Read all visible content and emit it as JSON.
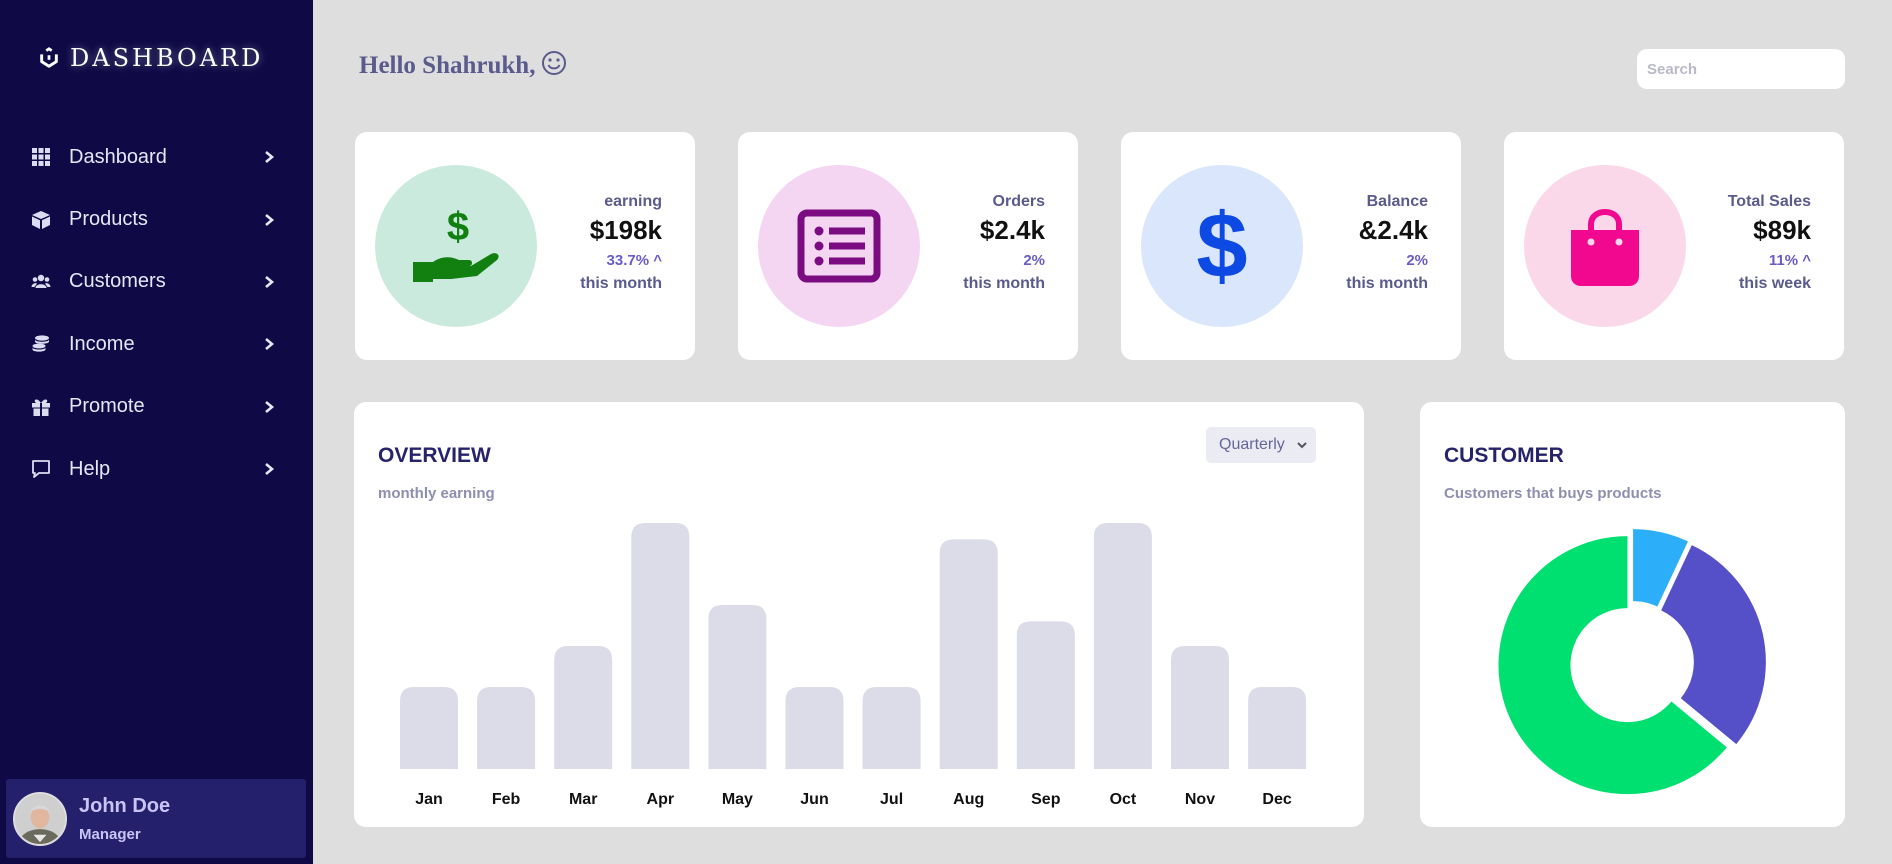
{
  "brand": {
    "title": "DASHBOARD"
  },
  "sidebar": {
    "items": [
      {
        "label": "Dashboard",
        "icon": "grid-icon"
      },
      {
        "label": "Products",
        "icon": "box-icon"
      },
      {
        "label": "Customers",
        "icon": "users-icon"
      },
      {
        "label": "Income",
        "icon": "coins-icon"
      },
      {
        "label": "Promote",
        "icon": "gift-icon"
      },
      {
        "label": "Help",
        "icon": "message-icon"
      }
    ]
  },
  "profile": {
    "name": "John Doe",
    "role": "Manager"
  },
  "header": {
    "greeting": "Hello Shahrukh,",
    "search_placeholder": "Search"
  },
  "cards": [
    {
      "title": "earning",
      "value": "$198k",
      "change": "33.7% ^",
      "period": "this month",
      "icon": "hand-dollar-icon",
      "circle_color": "#cbeade",
      "icon_color": "#118011"
    },
    {
      "title": "Orders",
      "value": "$2.4k",
      "change": "2%",
      "period": "this month",
      "icon": "list-icon",
      "circle_color": "#f4d6f2",
      "icon_color": "#7b0b80"
    },
    {
      "title": "Balance",
      "value": "&2.4k",
      "change": "2%",
      "period": "this month",
      "icon": "dollar-icon",
      "circle_color": "#d9e6fb",
      "icon_color": "#0d49e3"
    },
    {
      "title": "Total Sales",
      "value": "$89k",
      "change": "11% ^",
      "period": "this week",
      "icon": "shopping-bag-icon",
      "circle_color": "#fad8ea",
      "icon_color": "#f2088f"
    }
  ],
  "overview": {
    "title": "OVERVIEW",
    "subtitle": "monthly earning",
    "period_select": "Quarterly"
  },
  "customer": {
    "title": "CUSTOMER",
    "subtitle": "Customers that buys products"
  },
  "chart_data": [
    {
      "type": "bar",
      "title": "OVERVIEW",
      "subtitle": "monthly earning",
      "categories": [
        "Jan",
        "Feb",
        "Mar",
        "Apr",
        "May",
        "Jun",
        "Jul",
        "Aug",
        "Sep",
        "Oct",
        "Nov",
        "Dec"
      ],
      "values": [
        30,
        30,
        45,
        90,
        60,
        30,
        30,
        84,
        54,
        90,
        45,
        30
      ],
      "ylim": [
        0,
        90
      ],
      "color": "#dcdbe8",
      "grid": false
    },
    {
      "type": "pie",
      "title": "CUSTOMER",
      "subtitle": "Customers that buys products",
      "values": [
        7,
        29,
        64
      ],
      "colors": [
        "#2daef8",
        "#5650c8",
        "#00e071"
      ],
      "donut": true
    }
  ]
}
